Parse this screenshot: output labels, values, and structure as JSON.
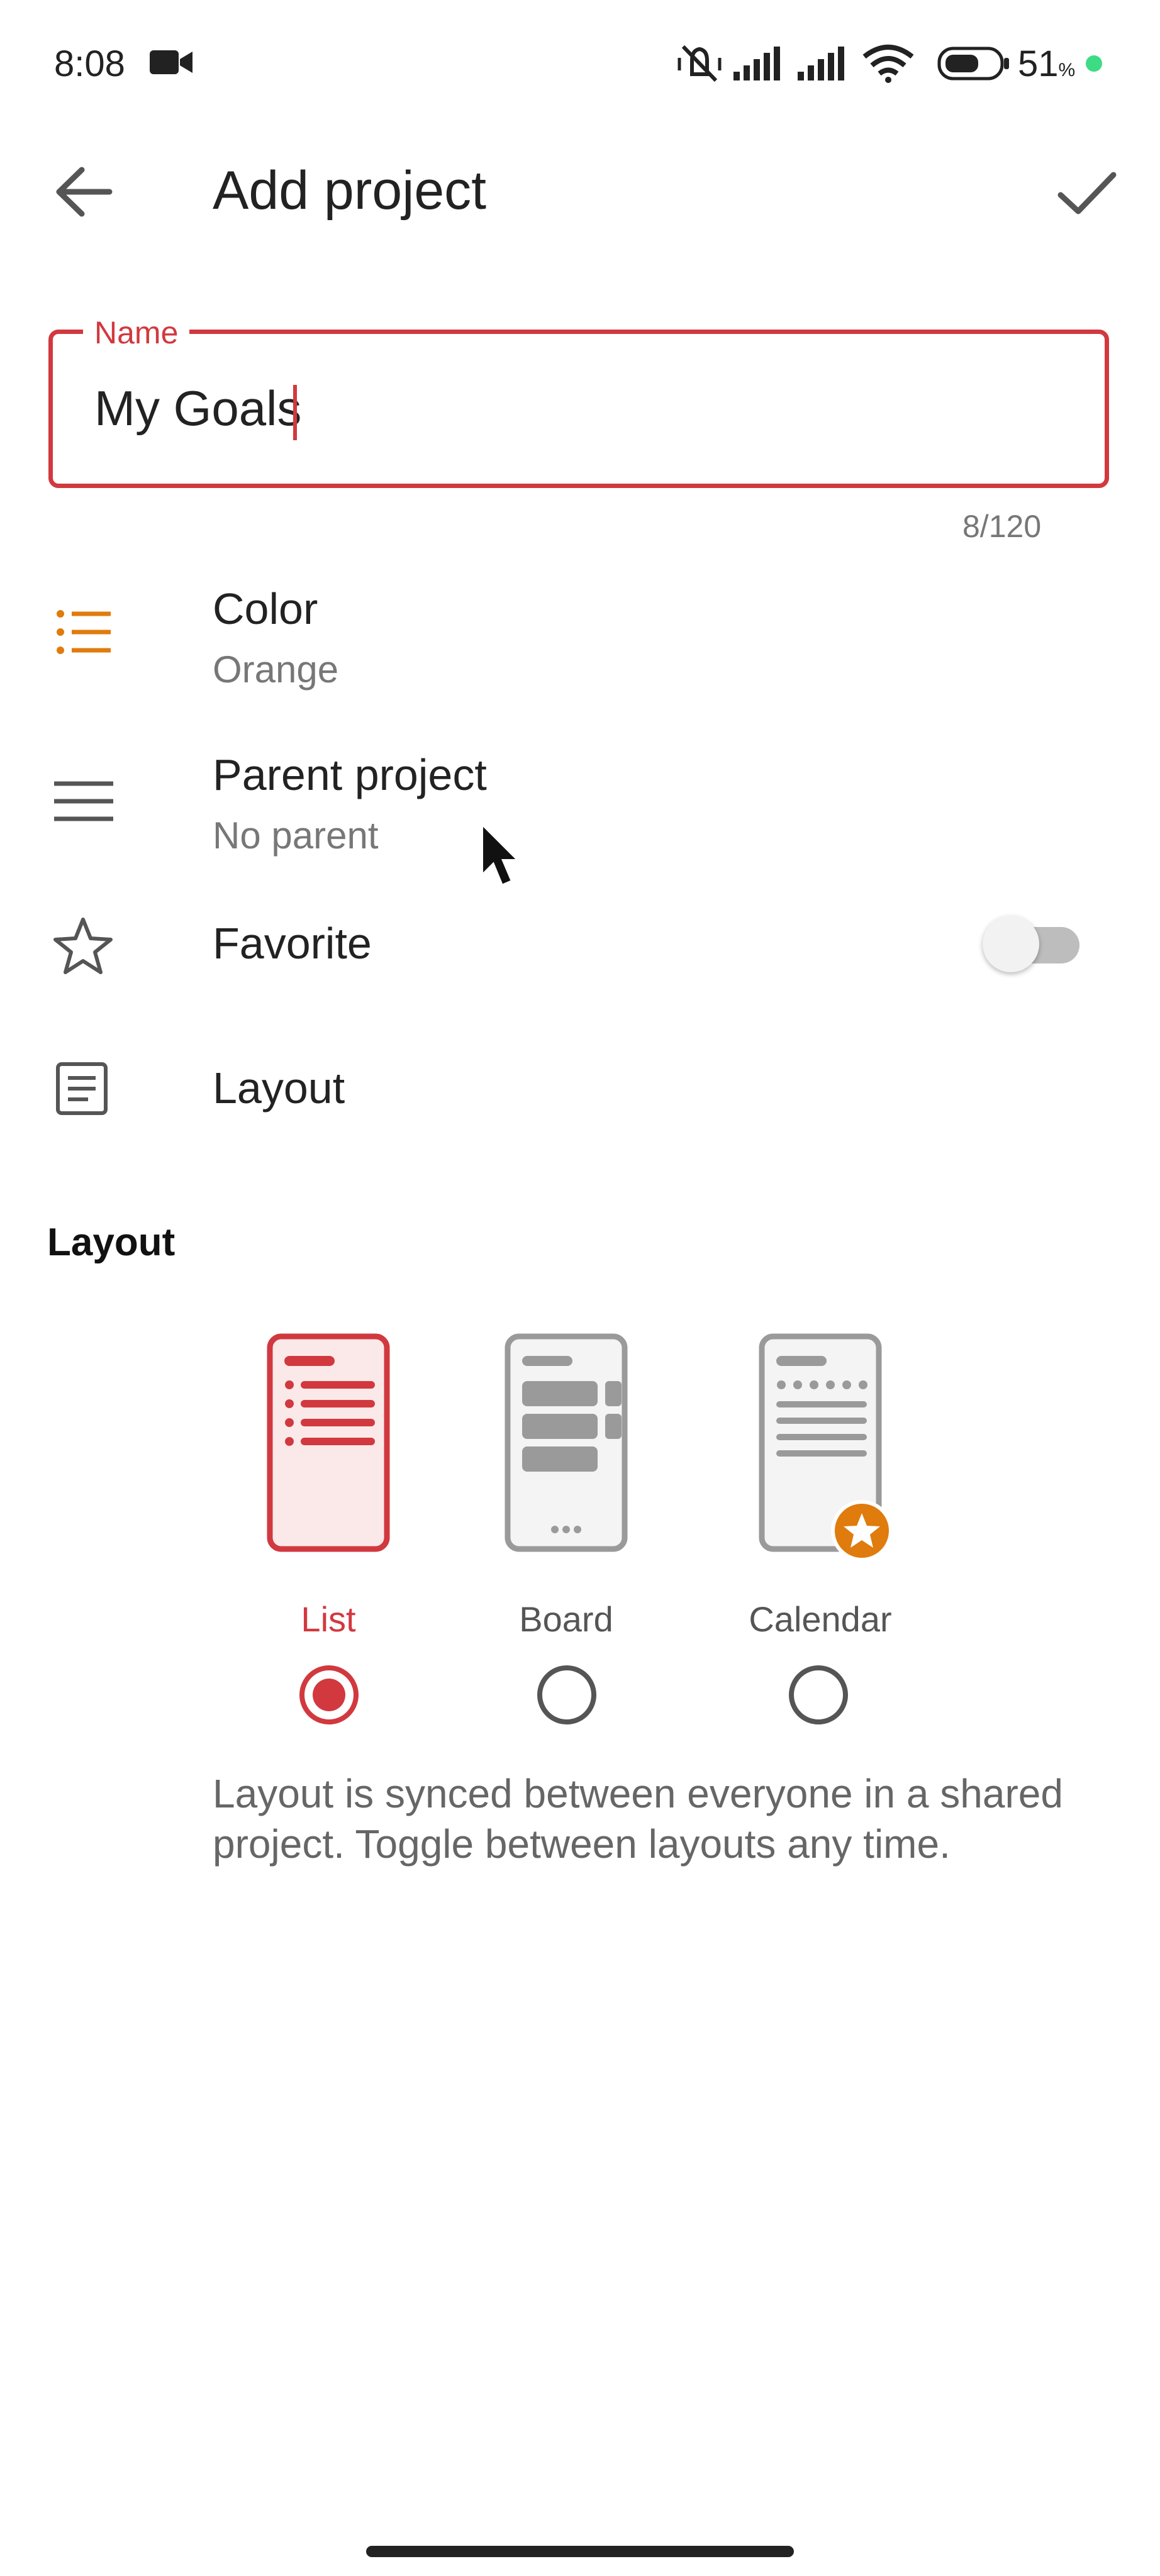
{
  "status_bar": {
    "time": "8:08",
    "battery": "51",
    "battery_unit": "%",
    "icons": [
      "video-camera-icon",
      "muted-vibrate-icon",
      "signal-icon",
      "signal-icon",
      "wifi-icon",
      "battery-icon",
      "dot-indicator-icon"
    ]
  },
  "app_bar": {
    "title": "Add project",
    "back_icon": "arrow-left-icon",
    "confirm_icon": "check-icon"
  },
  "name_field": {
    "label": "Name",
    "value": "My Goals",
    "counter": "8/120"
  },
  "settings": {
    "color": {
      "title": "Color",
      "value": "Orange",
      "icon": "list-icon",
      "icon_color": "#e07b0d"
    },
    "parent": {
      "title": "Parent project",
      "value": "No parent",
      "icon": "lines-icon"
    },
    "favorite": {
      "title": "Favorite",
      "icon": "star-outline-icon",
      "enabled": false
    },
    "layout": {
      "title": "Layout",
      "icon": "document-icon"
    }
  },
  "layout_section": {
    "heading": "Layout",
    "options": [
      {
        "label": "List",
        "selected": true
      },
      {
        "label": "Board",
        "selected": false
      },
      {
        "label": "Calendar",
        "selected": false,
        "badge": "star-badge-icon"
      }
    ],
    "description": "Layout is synced between everyone in a shared project. Toggle between layouts any time."
  },
  "colors": {
    "accent": "#d1393f",
    "orange": "#e07b0d",
    "text_primary": "#222222",
    "text_secondary": "#777777"
  }
}
